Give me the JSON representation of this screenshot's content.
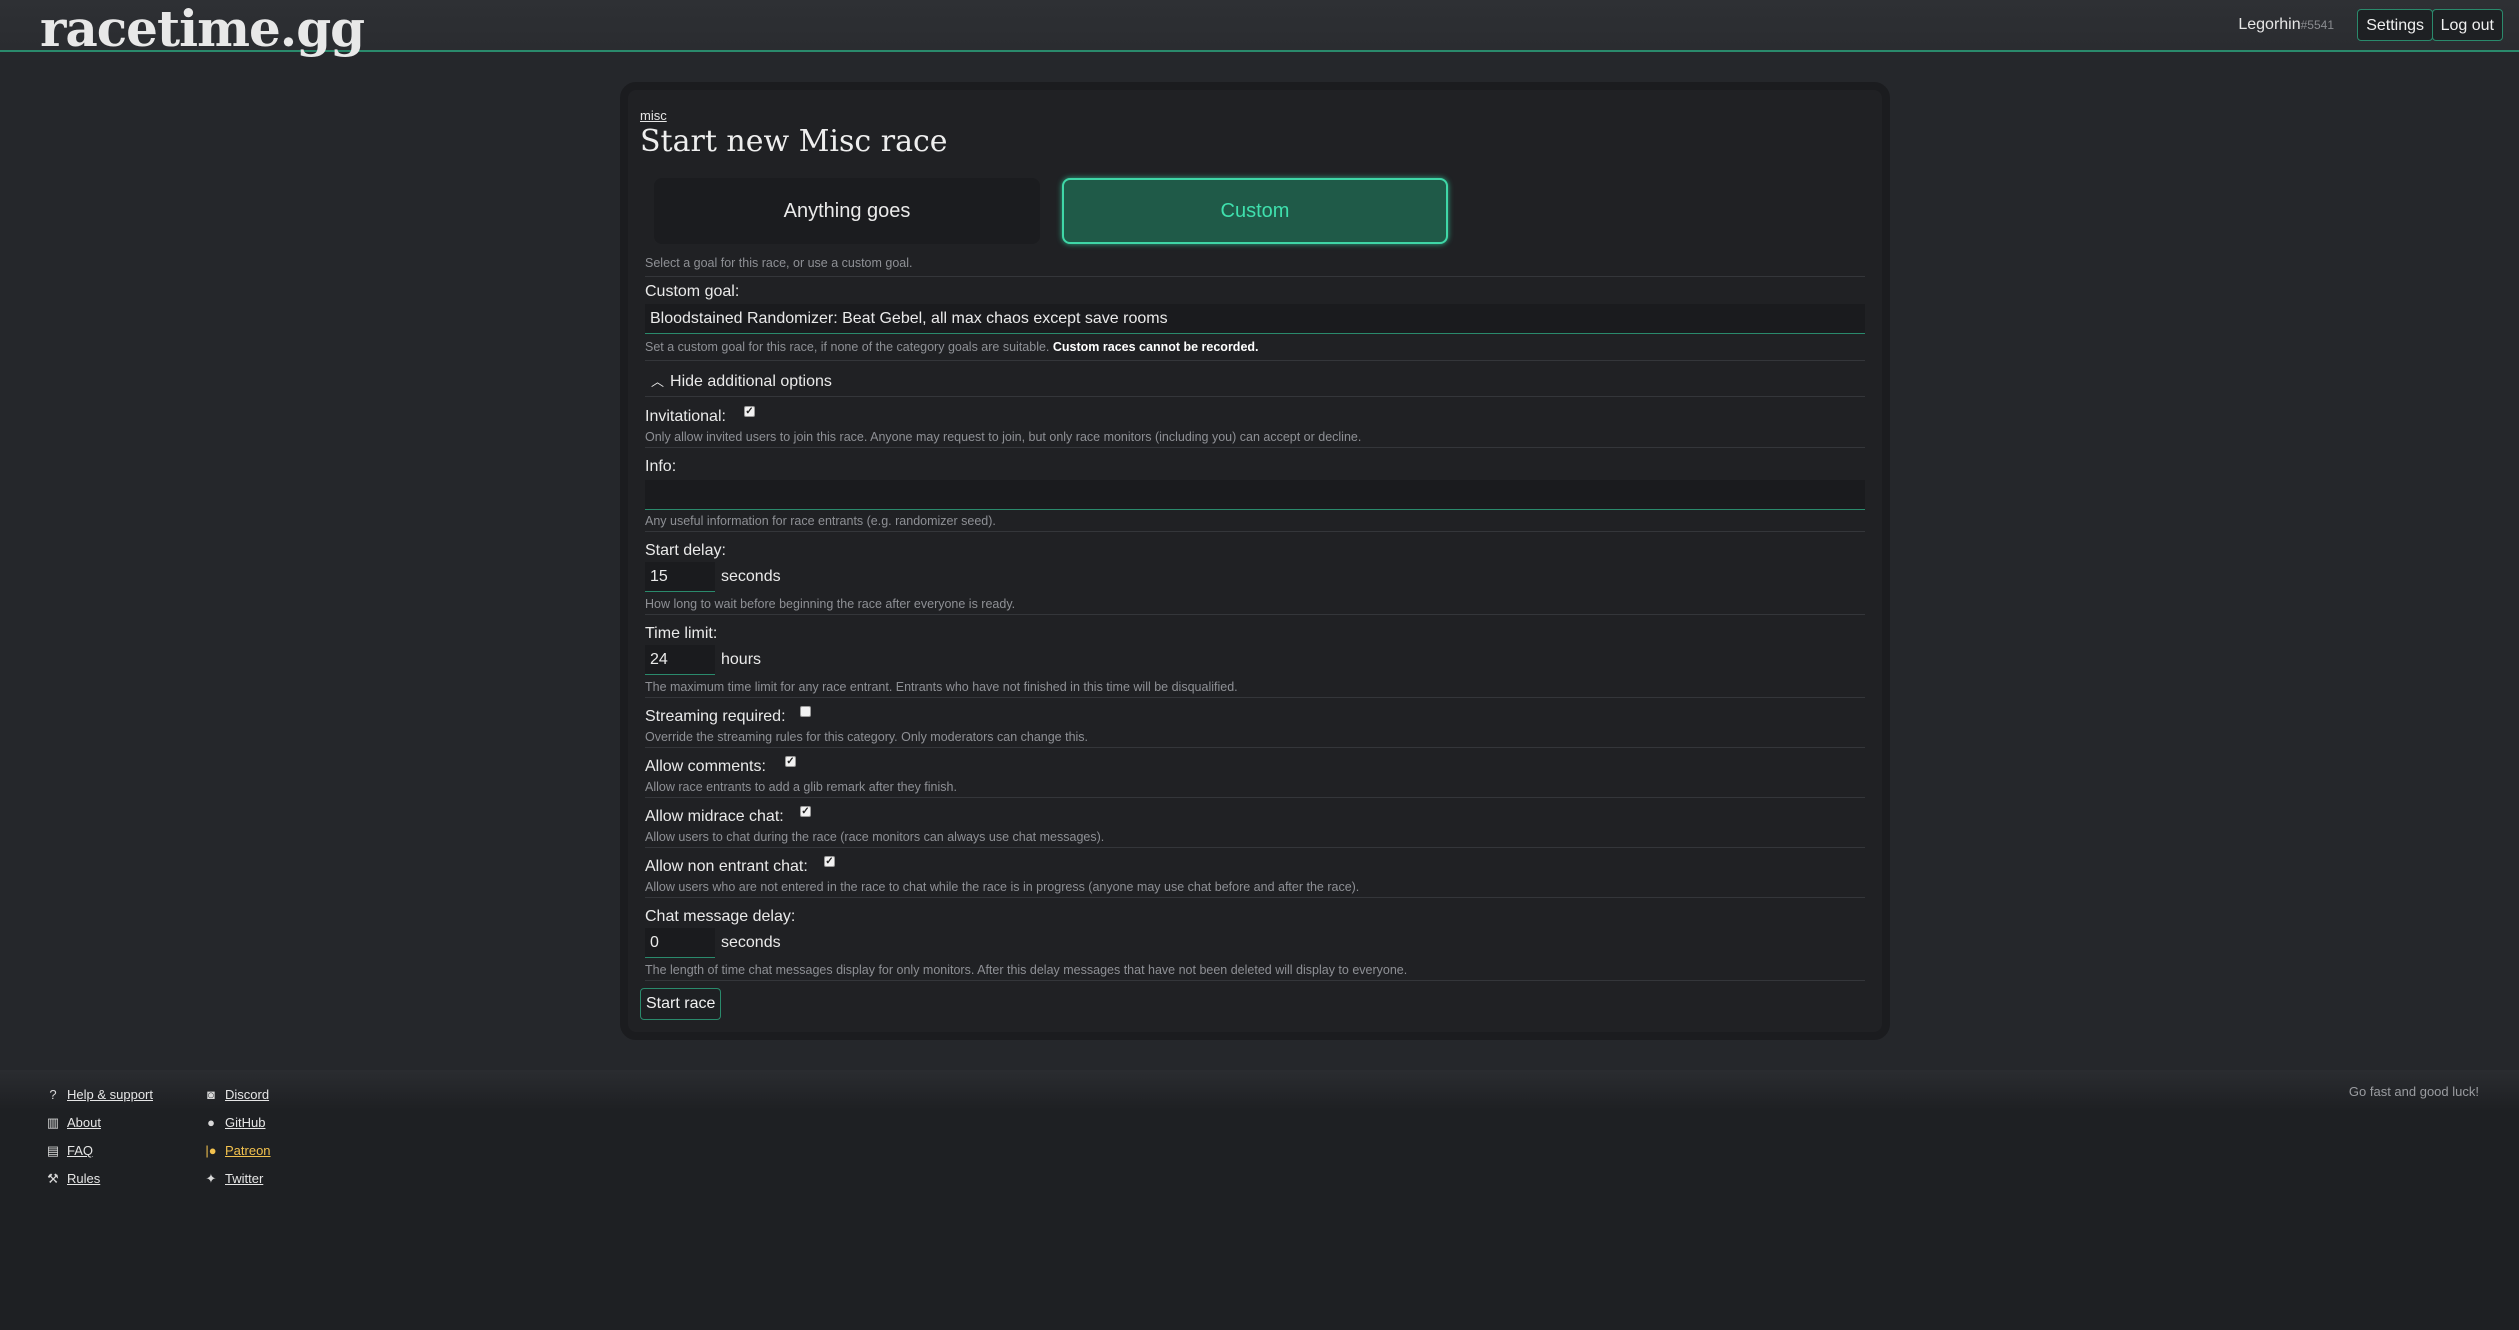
{
  "header": {
    "logo": "racetime.gg",
    "username": "Legorhin",
    "discriminator": "#5541",
    "settings_label": "Settings",
    "logout_label": "Log out"
  },
  "breadcrumb": "misc",
  "page_title": "Start new Misc race",
  "goals": {
    "options": [
      "Anything goes",
      "Custom"
    ],
    "selected": "Custom",
    "help": "Select a goal for this race, or use a custom goal."
  },
  "custom_goal": {
    "label": "Custom goal:",
    "value": "Bloodstained Randomizer: Beat Gebel, all max chaos except save rooms",
    "help": "Set a custom goal for this race, if none of the category goals are suitable.",
    "help_bold": "Custom races cannot be recorded."
  },
  "options_toggle": "Hide additional options",
  "invitational": {
    "label": "Invitational:",
    "checked": true,
    "help": "Only allow invited users to join this race. Anyone may request to join, but only race monitors (including you) can accept or decline."
  },
  "info": {
    "label": "Info:",
    "value": "",
    "help": "Any useful information for race entrants (e.g. randomizer seed)."
  },
  "start_delay": {
    "label": "Start delay:",
    "value": "15",
    "unit": "seconds",
    "help": "How long to wait before beginning the race after everyone is ready."
  },
  "time_limit": {
    "label": "Time limit:",
    "value": "24",
    "unit": "hours",
    "help": "The maximum time limit for any race entrant. Entrants who have not finished in this time will be disqualified."
  },
  "streaming_required": {
    "label": "Streaming required:",
    "checked": false,
    "help": "Override the streaming rules for this category. Only moderators can change this."
  },
  "allow_comments": {
    "label": "Allow comments:",
    "checked": true,
    "help": "Allow race entrants to add a glib remark after they finish."
  },
  "allow_midrace_chat": {
    "label": "Allow midrace chat:",
    "checked": true,
    "help": "Allow users to chat during the race (race monitors can always use chat messages)."
  },
  "allow_non_entrant_chat": {
    "label": "Allow non entrant chat:",
    "checked": true,
    "help": "Allow users who are not entered in the race to chat while the race is in progress (anyone may use chat before and after the race)."
  },
  "chat_message_delay": {
    "label": "Chat message delay:",
    "value": "0",
    "unit": "seconds",
    "help": "The length of time chat messages display for only monitors. After this delay messages that have not been deleted will display to everyone."
  },
  "submit_label": "Start race",
  "footer": {
    "col1": [
      {
        "label": "Help & support",
        "icon": "help-circle-icon"
      },
      {
        "label": "About",
        "icon": "building-icon"
      },
      {
        "label": "FAQ",
        "icon": "chat-bubbles-icon"
      },
      {
        "label": "Rules",
        "icon": "gavel-icon"
      }
    ],
    "col2": [
      {
        "label": "Discord",
        "icon": "discord-icon"
      },
      {
        "label": "GitHub",
        "icon": "github-icon"
      },
      {
        "label": "Patreon",
        "icon": "patreon-icon"
      },
      {
        "label": "Twitter",
        "icon": "twitter-icon"
      }
    ],
    "tagline": "Go fast and good luck!"
  }
}
